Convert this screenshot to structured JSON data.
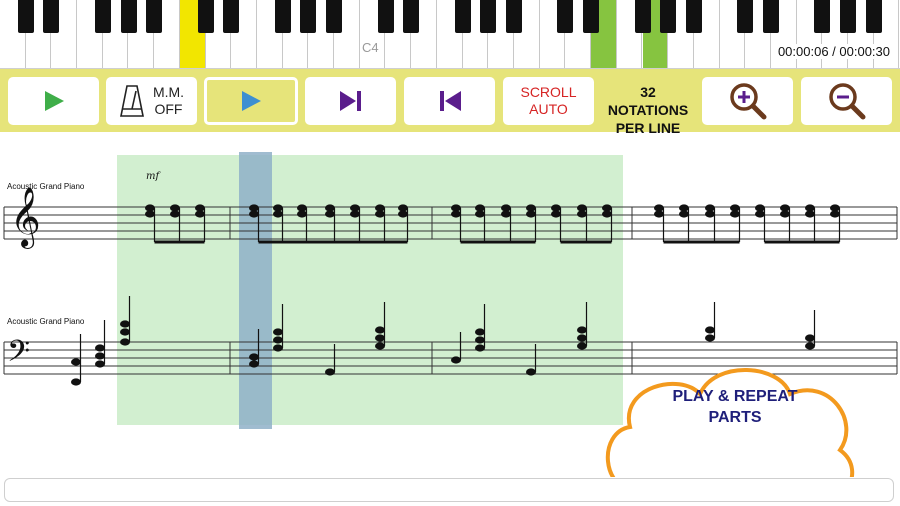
{
  "keyboard": {
    "middle_c_label": "C4",
    "time": "00:00:06 / 00:00:30",
    "highlight_color": "#f2e600",
    "highlight_color_2": "#86c440"
  },
  "toolbar": {
    "play_icon": "play-icon",
    "metronome": {
      "line1": "M.M.",
      "line2": "OFF"
    },
    "play_selection_icon": "play-icon",
    "next_icon": "skip-next-icon",
    "prev_icon": "skip-previous-icon",
    "scroll": {
      "line1": "SCROLL",
      "line2": "AUTO"
    },
    "notations": {
      "line1": "32 NOTATIONS",
      "line2": "PER LINE"
    },
    "zoom_in_icon": "zoom-in-icon",
    "zoom_out_icon": "zoom-out-icon",
    "background": "#e6e47a"
  },
  "score": {
    "instrument_top": "Acoustic Grand Piano",
    "instrument_bottom": "Acoustic Grand Piano",
    "dynamic": "mf",
    "selection_color": "#d2efd0",
    "playhead_color": "#8fb0c8"
  },
  "callout": {
    "line1": "PLAY & REPEAT",
    "line2": "PARTS",
    "border_color": "#f39a1e"
  }
}
